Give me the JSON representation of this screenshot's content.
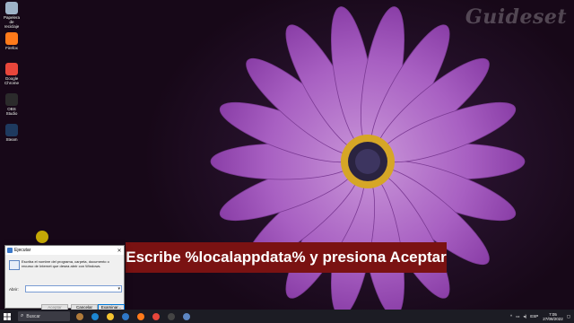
{
  "watermark": "Guideset",
  "desktop": {
    "icons": [
      {
        "label": "Papelera de reciclaje",
        "icon": "recycle-bin-icon",
        "color": "#9fb3c8"
      },
      {
        "label": "Firefox",
        "icon": "firefox-icon",
        "color": "#ff7a1a"
      },
      {
        "label": "Google Chrome",
        "icon": "chrome-icon",
        "color": "#e8463b"
      },
      {
        "label": "OBS Studio",
        "icon": "obs-icon",
        "color": "#2b2b2b"
      },
      {
        "label": "Steam",
        "icon": "steam-icon",
        "color": "#1e3a5f"
      }
    ]
  },
  "caption": "Escribe %localappdata% y presiona Aceptar",
  "run_dialog": {
    "title": "Ejecutar",
    "close_glyph": "✕",
    "description": "Escriba el nombre del programa, carpeta, documento o recurso de Internet que desea abrir con Windows.",
    "open_label": "Abrir:",
    "input_value": "",
    "buttons": {
      "accept": "Aceptar",
      "cancel": "Cancelar",
      "browse": "Examinar..."
    }
  },
  "taskbar": {
    "search_placeholder": "Buscar",
    "apps": [
      {
        "icon": "saturn-icon",
        "color": "#b07a3a"
      },
      {
        "icon": "edge-icon",
        "color": "#1d86d1"
      },
      {
        "icon": "file-explorer-icon",
        "color": "#f4c430"
      },
      {
        "icon": "store-icon",
        "color": "#2f78c8"
      },
      {
        "icon": "firefox-icon",
        "color": "#ff7a1a"
      },
      {
        "icon": "chrome-icon",
        "color": "#e8463b"
      },
      {
        "icon": "obs-icon",
        "color": "#444444"
      },
      {
        "icon": "run-icon",
        "color": "#5d86c3"
      }
    ],
    "tray": {
      "language": "ESP",
      "time": "7:05",
      "date": "27/08/2022"
    }
  },
  "colors": {
    "caption_bg": "#7a1212",
    "taskbar_bg": "#1c1c24",
    "accent": "#0078d7"
  }
}
